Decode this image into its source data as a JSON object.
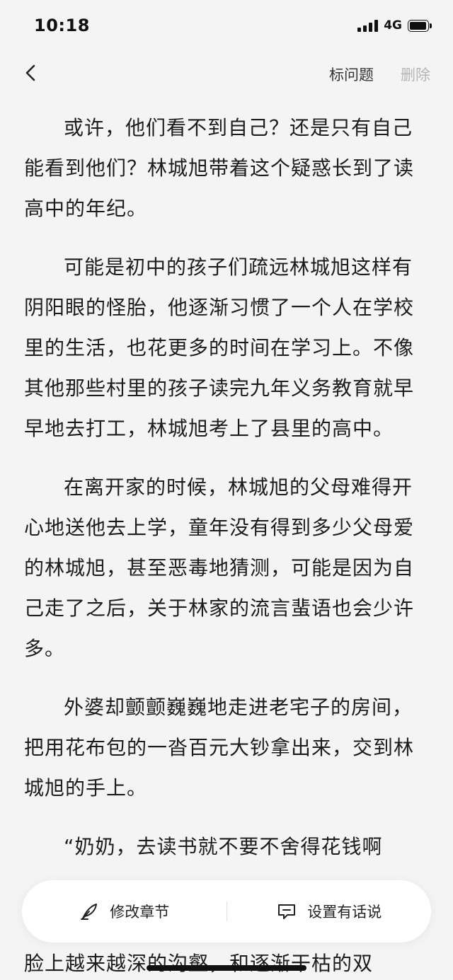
{
  "status": {
    "time": "10:18",
    "network": "4G"
  },
  "nav": {
    "mark_question": "标问题",
    "delete": "删除"
  },
  "content": {
    "paragraphs": [
      "或许，他们看不到自己？还是只有自己能看到他们？林城旭带着这个疑惑长到了读高中的年纪。",
      "可能是初中的孩子们疏远林城旭这样有阴阳眼的怪胎，他逐渐习惯了一个人在学校里的生活，也花更多的时间在学习上。不像其他那些村里的孩子读完九年义务教育就早早地去打工，林城旭考上了县里的高中。",
      "在离开家的时候，林城旭的父母难得开心地送他去上学，童年没有得到多少父母爱的林城旭，甚至恶毒地猜测，可能是因为自己走了之后，关于林家的流言蜚语也会少许多。",
      "外婆却颤颤巍巍地走进老宅子的房间，把用花布包的一沓百元大钞拿出来，交到林城旭的手上。"
    ],
    "partial_line": "“奶奶，去读书就不要不舍得花钱啊",
    "last_line": "脸上越来越深的沟壑，和逐渐干枯的双"
  },
  "actions": {
    "edit_chapter": "修改章节",
    "author_note": "设置有话说"
  },
  "icons": {
    "back": "chevron-left-icon",
    "edit": "feather-pen-icon",
    "note": "speech-bubble-icon"
  }
}
